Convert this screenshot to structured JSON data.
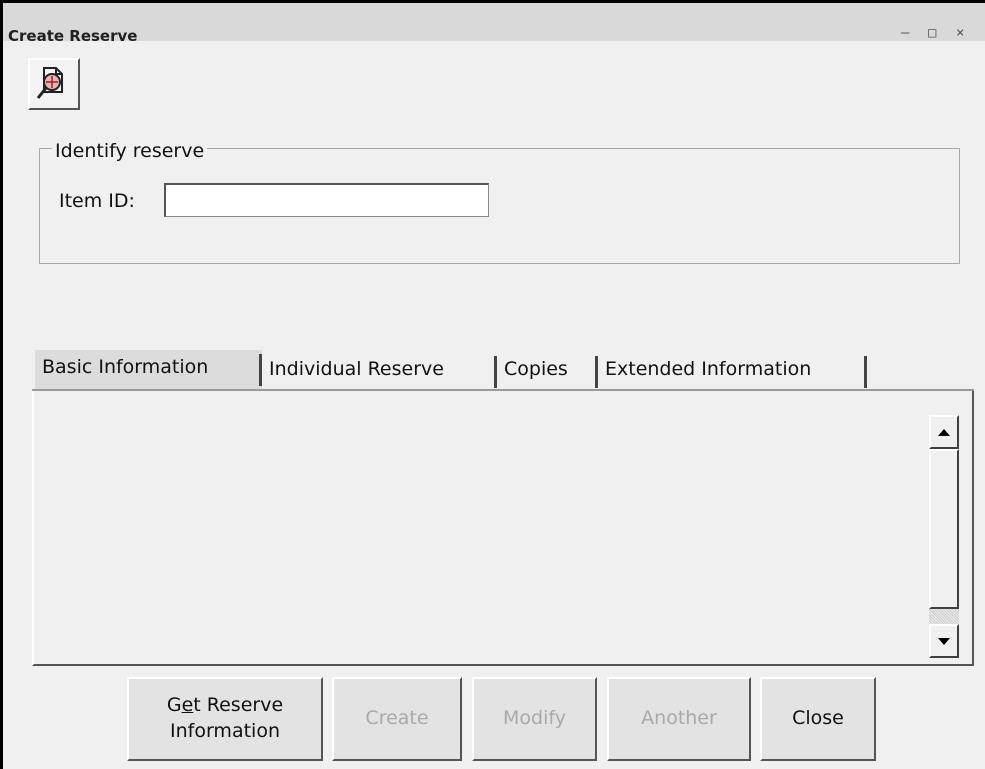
{
  "window": {
    "title": "Create Reserve",
    "controls": {
      "minimize": "–",
      "maximize": "□",
      "close": "×"
    }
  },
  "toolbar": {
    "search_icon": "search-patron-icon"
  },
  "identify": {
    "legend": "Identify reserve",
    "item_id_label": "Item ID:",
    "item_id_value": ""
  },
  "tabs": [
    {
      "label": "Basic Information",
      "active": true
    },
    {
      "label": "Individual Reserve",
      "active": false
    },
    {
      "label": "Copies",
      "active": false
    },
    {
      "label": "Extended Information",
      "active": false
    }
  ],
  "buttons": {
    "get_reserve_line1_pre": "G",
    "get_reserve_line1_u": "e",
    "get_reserve_line1_post": "t Reserve",
    "get_reserve_line2": "Information",
    "create": "Create",
    "modify": "Modify",
    "another": "Another",
    "close": "Close"
  }
}
